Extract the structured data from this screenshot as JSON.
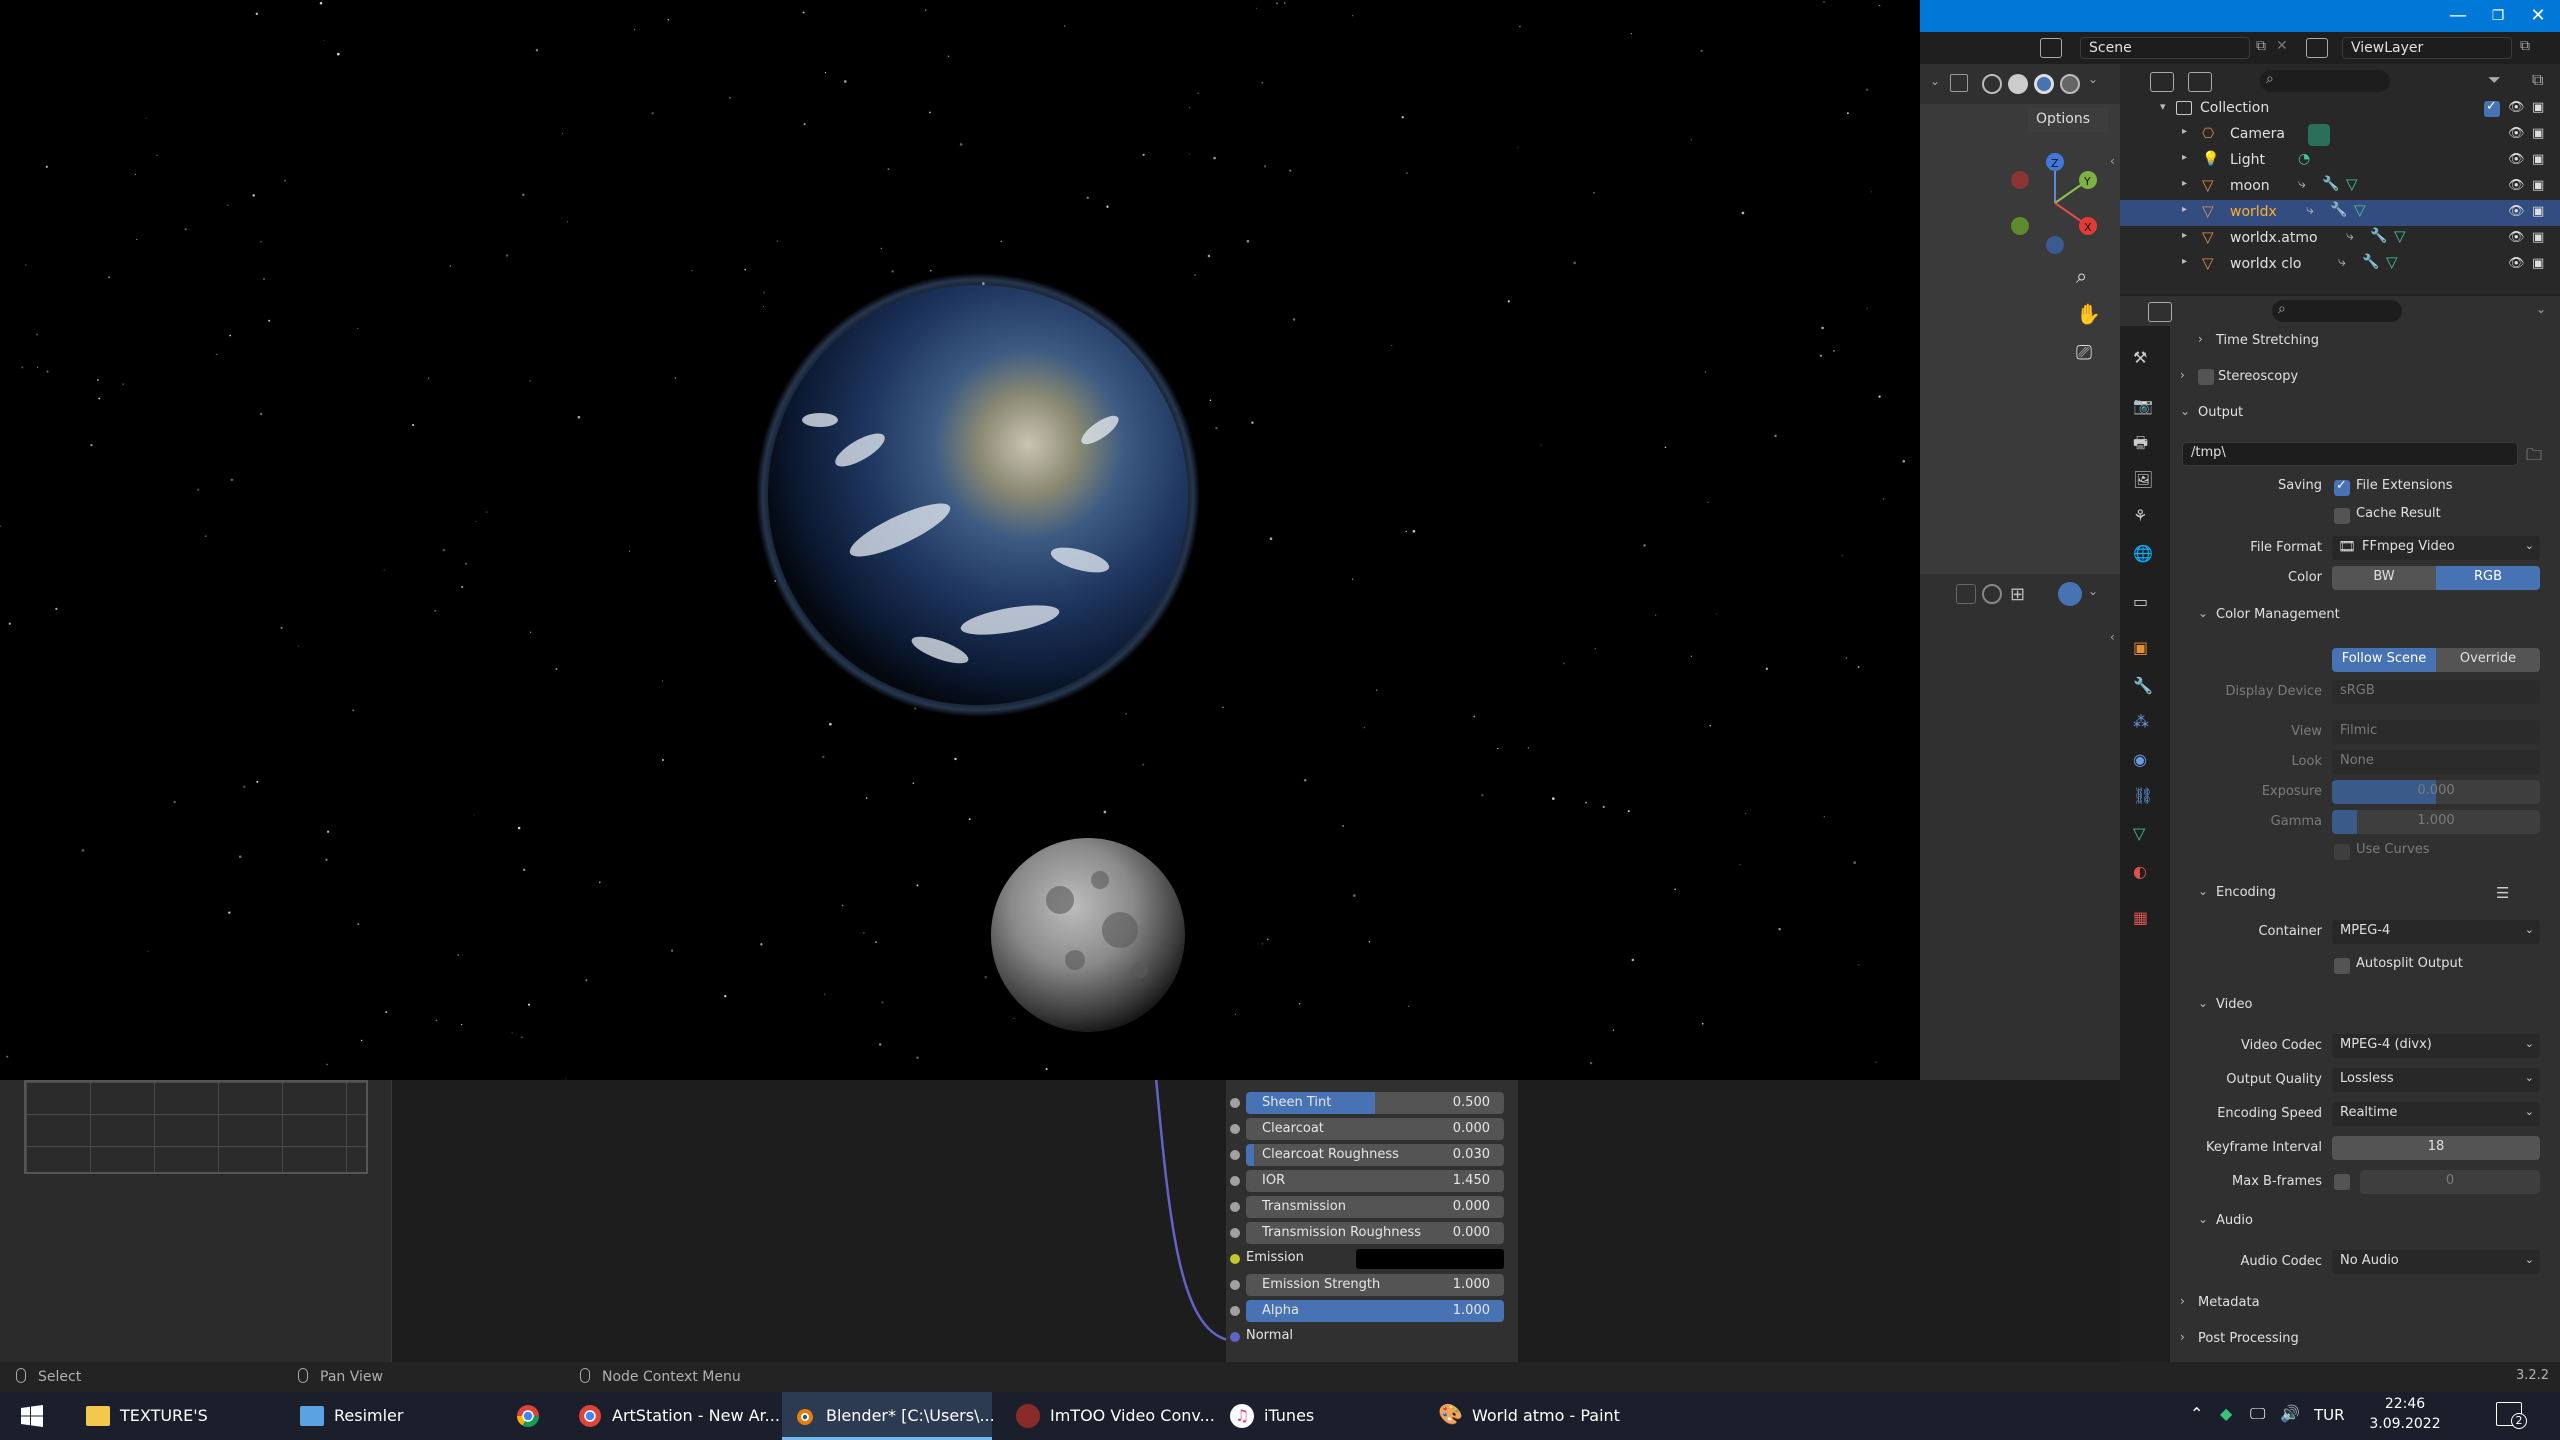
{
  "window": {
    "scene_label": "Scene",
    "view_layer_label": "ViewLayer",
    "options_label": "Options"
  },
  "outliner": {
    "collection": "Collection",
    "items": [
      {
        "name": "Camera"
      },
      {
        "name": "Light"
      },
      {
        "name": "moon"
      },
      {
        "name": "worldx",
        "selected": true
      },
      {
        "name": "worldx.atmo"
      },
      {
        "name": "worldx clo"
      }
    ]
  },
  "properties": {
    "time_stretching": "Time Stretching",
    "stereoscopy": "Stereoscopy",
    "output": "Output",
    "output_path": "/tmp\\",
    "saving_label": "Saving",
    "file_extensions": "File Extensions",
    "cache_result": "Cache Result",
    "file_format_label": "File Format",
    "file_format_value": "FFmpeg Video",
    "color_label": "Color",
    "color_bw": "BW",
    "color_rgb": "RGB",
    "color_management": "Color Management",
    "follow_scene": "Follow Scene",
    "override": "Override",
    "display_device_label": "Display Device",
    "display_device_value": "sRGB",
    "view_label": "View",
    "view_value": "Filmic",
    "look_label": "Look",
    "look_value": "None",
    "exposure_label": "Exposure",
    "exposure_value": "0.000",
    "gamma_label": "Gamma",
    "gamma_value": "1.000",
    "use_curves": "Use Curves",
    "encoding": "Encoding",
    "container_label": "Container",
    "container_value": "MPEG-4",
    "autosplit_output": "Autosplit Output",
    "video": "Video",
    "video_codec_label": "Video Codec",
    "video_codec_value": "MPEG-4 (divx)",
    "output_quality_label": "Output Quality",
    "output_quality_value": "Lossless",
    "encoding_speed_label": "Encoding Speed",
    "encoding_speed_value": "Realtime",
    "keyframe_interval_label": "Keyframe Interval",
    "keyframe_interval_value": "18",
    "max_bframes_label": "Max B-frames",
    "max_bframes_value": "0",
    "audio": "Audio",
    "audio_codec_label": "Audio Codec",
    "audio_codec_value": "No Audio",
    "metadata": "Metadata",
    "post_processing": "Post Processing",
    "version": "3.2.2"
  },
  "node": {
    "rows": [
      {
        "label": "Sheen Tint",
        "value": "0.500",
        "fill": 0.5
      },
      {
        "label": "Clearcoat",
        "value": "0.000",
        "fill": 0
      },
      {
        "label": "Clearcoat Roughness",
        "value": "0.030",
        "fill": 0.03
      },
      {
        "label": "IOR",
        "value": "1.450",
        "fill": 0
      },
      {
        "label": "Transmission",
        "value": "0.000",
        "fill": 0
      },
      {
        "label": "Transmission Roughness",
        "value": "0.000",
        "fill": 0
      },
      {
        "label": "Emission"
      },
      {
        "label": "Emission Strength",
        "value": "1.000",
        "fill": 0
      },
      {
        "label": "Alpha",
        "value": "1.000",
        "fill": 1
      },
      {
        "label": "Normal"
      }
    ]
  },
  "statusbar": {
    "select": "Select",
    "pan_view": "Pan View",
    "node_context_menu": "Node Context Menu"
  },
  "taskbar": {
    "items": [
      {
        "label": "TEXTURE'S"
      },
      {
        "label": "Resimler"
      },
      {
        "label": ""
      },
      {
        "label": "ArtStation - New Ar..."
      },
      {
        "label": "Blender* [C:\\Users\\..."
      },
      {
        "label": "ImTOO Video Conv..."
      },
      {
        "label": "iTunes"
      },
      {
        "label": "World atmo - Paint"
      }
    ],
    "language": "TUR",
    "time": "22:46",
    "date": "3.09.2022",
    "notification_count": "2"
  },
  "colors": {
    "accent": "#4772b3",
    "selected": "#334d80",
    "titlebar": "#0078d7"
  }
}
